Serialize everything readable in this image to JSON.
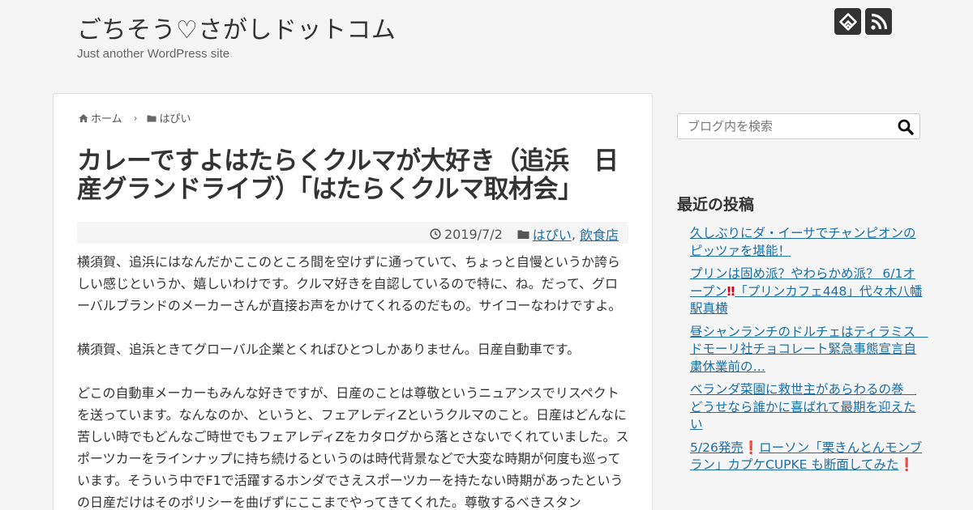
{
  "header": {
    "site_title": "ごちそう♡さがしドットコム",
    "site_description": "Just another WordPress site",
    "icons": [
      "feedly-icon",
      "rss-icon"
    ]
  },
  "breadcrumb": {
    "home": "ホーム",
    "category": "はぴい"
  },
  "article": {
    "title": "カレーですよはたらくクルマが大好き（追浜　日産グランドライブ）「はたらくクルマ取材会」",
    "date": "2019/7/2",
    "categories": [
      "はぴい",
      "飲食店"
    ],
    "paragraphs": [
      "横須賀、追浜にはなんだかここのところ間を空けずに通っていて、ちょっと自慢というか誇らしい感じというか、嬉しいわけです。クルマ好きを自認しているので特に、ね。だって、グローバルブランドのメーカーさんが直接お声をかけてくれるのだもの。サイコーなわけですよ。",
      "横須賀、追浜ときてグローバル企業とくればひとつしかありません。日産自動車です。",
      "どこの自動車メーカーもみんな好きですが、日産のことは尊敬というニュアンスでリスペクトを送っています。なんなのか、というと、フェアレディZというクルマのこと。日産はどんなに苦しい時でもどんなご時世でもフェアレディZをカタログから落とさないでくれていました。スポーツカーをラインナップに持ち続けるというのは時代背景などで大変な時期が何度も巡っています。そういう中でF1で活躍するホンダでさえスポーツカーを持たない時期があったというの日産だけはそのポリシーを曲げずにここまでやってきてくれた。尊敬するべきスタン"
    ]
  },
  "sidebar": {
    "search_placeholder": "ブログ内を検索",
    "recent_title": "最近の投稿",
    "recent_posts": [
      {
        "before": "久しぶりにダ・イーサでチャンピオンのピッツァを堪能！",
        "mark": "",
        "after": ""
      },
      {
        "before": "プリンは固め派？やわらかめ派？ 6/1オープン",
        "mark": "‼",
        "after": "「プリンカフェ448」代々木八幡 駅真横"
      },
      {
        "before": "昼シャンランチのドルチェはティラミス　ドモーリ社チョコレート緊急事態宣言自粛休業前の…",
        "mark": "",
        "after": ""
      },
      {
        "before": "ベランダ菜園に救世主があらわるの巻　どうせなら誰かに喜ばれて最期を迎えたい",
        "mark": "",
        "after": ""
      },
      {
        "before": "5/26発売",
        "mark": "❗",
        "after": "ローソン「栗きんとんモンブラン」カプケCUPKE も断面してみた",
        "mark2": "❗"
      }
    ]
  }
}
